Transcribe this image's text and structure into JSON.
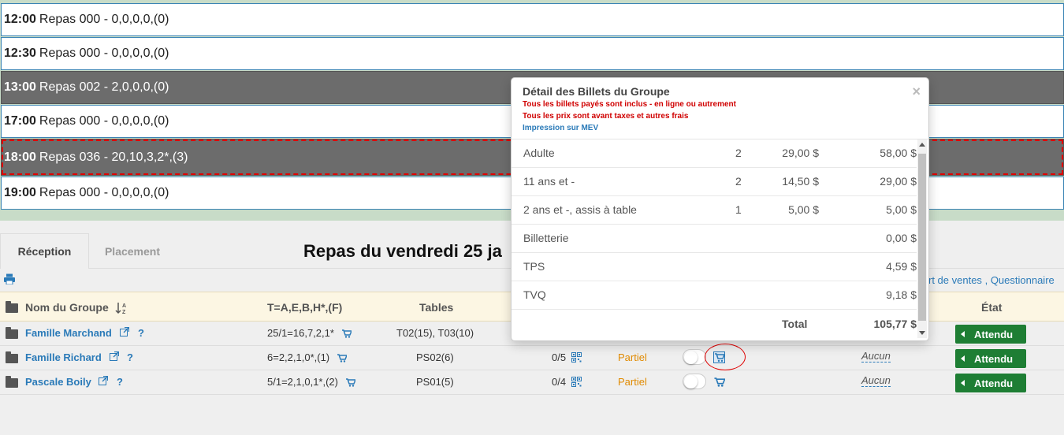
{
  "slots": [
    {
      "time": "12:00",
      "label": "Repas 000 - 0,0,0,0,(0)"
    },
    {
      "time": "12:30",
      "label": "Repas 000 - 0,0,0,0,(0)"
    },
    {
      "time": "13:00",
      "label": "Repas 002 - 2,0,0,0,(0)"
    },
    {
      "time": "17:00",
      "label": "Repas 000 - 0,0,0,0,(0)"
    },
    {
      "time": "18:00",
      "label": "Repas 036 - 20,10,3,2*,(3)"
    },
    {
      "time": "19:00",
      "label": "Repas 000 - 0,0,0,0,(0)"
    }
  ],
  "tabs": {
    "reception": "Réception",
    "placement": "Placement"
  },
  "page_title": "Repas du vendredi 25 ja",
  "links": {
    "rapport": "rt de ventes",
    "sep": ",",
    "questionnaire": "Questionnaire"
  },
  "headers": {
    "nom": "Nom du Groupe",
    "sort_icon": "sort-alpha-icon",
    "composition": "T=A,E,B,H*,(F)",
    "tables": "Tables",
    "etat": "État"
  },
  "groups": [
    {
      "name": "Famille Marchand",
      "q": "?",
      "composition": "25/1=16,7,2,1*",
      "tables": "T02(15), T03(10)",
      "etat": "Attendu"
    },
    {
      "name": "Famille Richard",
      "q": "?",
      "composition": "6=2,2,1,0*,(1)",
      "tables": "PS02(6)",
      "ratio": "0/5",
      "statut": "Partiel",
      "aucun": "Aucun",
      "etat": "Attendu"
    },
    {
      "name": "Pascale Boily",
      "q": "?",
      "composition": "5/1=2,1,0,1*,(2)",
      "tables": "PS01(5)",
      "ratio": "0/4",
      "statut": "Partiel",
      "aucun": "Aucun",
      "etat": "Attendu"
    }
  ],
  "popover": {
    "title": "Détail des Billets du Groupe",
    "note1": "Tous les billets payés sont inclus - en ligne ou autrement",
    "note2": "Tous les prix sont avant taxes et autres frais",
    "print": "Impression sur MEV",
    "close": "×",
    "rows": [
      {
        "label": "Adulte",
        "qty": "2",
        "unit": "29,00 $",
        "total": "58,00 $"
      },
      {
        "label": "11 ans et -",
        "qty": "2",
        "unit": "14,50 $",
        "total": "29,00 $"
      },
      {
        "label": "2 ans et -, assis à table",
        "qty": "1",
        "unit": "5,00 $",
        "total": "5,00 $"
      },
      {
        "label": "Billetterie",
        "qty": "",
        "unit": "",
        "total": "0,00 $"
      },
      {
        "label": "TPS",
        "qty": "",
        "unit": "",
        "total": "4,59 $"
      },
      {
        "label": "TVQ",
        "qty": "",
        "unit": "",
        "total": "9,18 $"
      }
    ],
    "total_label": "Total",
    "total_value": "105,77 $"
  },
  "colors": {
    "accent": "#2a7ab8",
    "dark_slot": "#6c6c6c",
    "success": "#1e7e34",
    "warning": "#e08a00",
    "alert": "#d00000"
  }
}
